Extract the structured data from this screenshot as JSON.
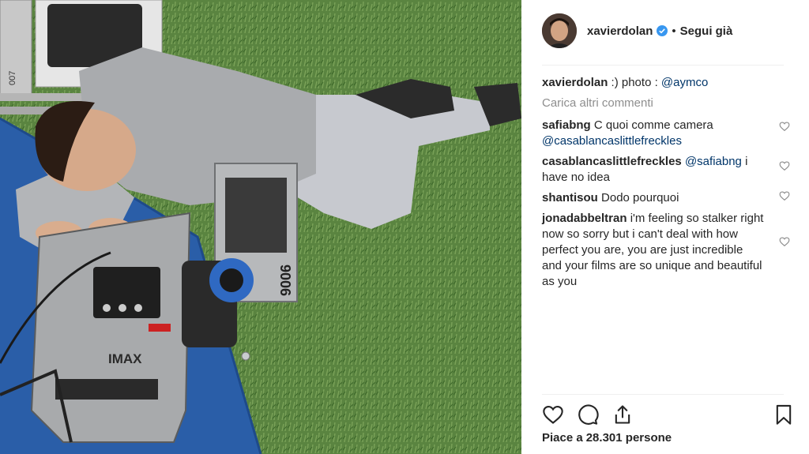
{
  "post": {
    "image_icon": "photo-sleeping-on-imax-camera",
    "camera_label": "IMAX",
    "case_number": "9006",
    "rig_label": "007"
  },
  "header": {
    "username": "xavierdolan",
    "verified_icon": "verified-badge-icon",
    "separator": "•",
    "follow_label": "Segui già"
  },
  "caption": {
    "username": "xavierdolan",
    "text": ":) photo : ",
    "mention": "@aymco"
  },
  "load_more": "Carica altri commenti",
  "comments": [
    {
      "username": "safiabng",
      "text": "C quoi comme camera ",
      "mention": "@casablancaslittlefreckles",
      "after": ""
    },
    {
      "username": "casablancaslittlefreckles",
      "text": "",
      "mention": "@safiabng",
      "after": " i have no idea"
    },
    {
      "username": "shantisou",
      "text": "Dodo pourquoi",
      "mention": "",
      "after": ""
    },
    {
      "username": "jonadabbeltran",
      "text": "i'm feeling so stalker right now so sorry but i can't deal with how perfect you are, you are just incredible and your films are so unique and beautiful as you",
      "mention": "",
      "after": ""
    }
  ],
  "actions": {
    "like_icon": "heart-icon",
    "comment_icon": "comment-icon",
    "share_icon": "share-icon",
    "save_icon": "bookmark-icon"
  },
  "likes": {
    "prefix": "Piace a",
    "count": "28.301",
    "suffix": "persone"
  },
  "colors": {
    "mention": "#003569",
    "muted": "#8e8e8e",
    "text": "#262626",
    "verified": "#3897f0"
  }
}
